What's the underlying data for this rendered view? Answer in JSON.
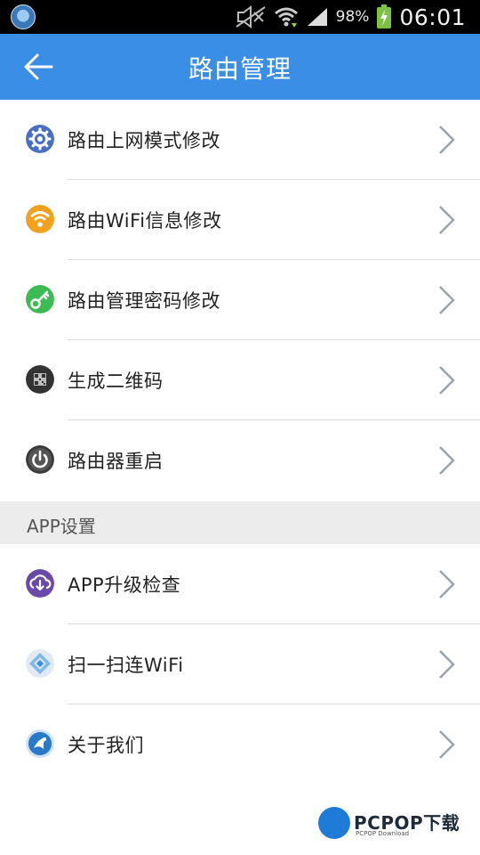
{
  "status_bar": {
    "battery": "98%",
    "time": "06:01"
  },
  "app_bar": {
    "title": "路由管理",
    "back_icon": "arrow-left-icon"
  },
  "router_items": [
    {
      "label": "路由上网模式修改",
      "icon": "gear-icon",
      "icon_color": "#4a6ec8"
    },
    {
      "label": "路由WiFi信息修改",
      "icon": "wifi-icon",
      "icon_color": "#f2a11f"
    },
    {
      "label": "路由管理密码修改",
      "icon": "key-icon",
      "icon_color": "#3cba54"
    },
    {
      "label": "生成二维码",
      "icon": "qrcode-icon",
      "icon_color": "#333333"
    },
    {
      "label": "路由器重启",
      "icon": "power-icon",
      "icon_color": "#3a3a3a"
    }
  ],
  "app_section": {
    "header": "APP设置",
    "items": [
      {
        "label": "APP升级检查",
        "icon": "cloud-download-icon",
        "icon_color": "#6a4aa8"
      },
      {
        "label": "扫一扫连WiFi",
        "icon": "scan-icon",
        "icon_color": "#7fb8e6"
      },
      {
        "label": "关于我们",
        "icon": "app-logo-icon",
        "icon_color": "#2a78c8"
      }
    ]
  },
  "watermark": {
    "text": "PCPOP下载",
    "sub": "PCPOP Download"
  },
  "colors": {
    "accent": "#3a8ee6",
    "chevron": "#9aa3ad",
    "section_bg": "#ececec"
  }
}
